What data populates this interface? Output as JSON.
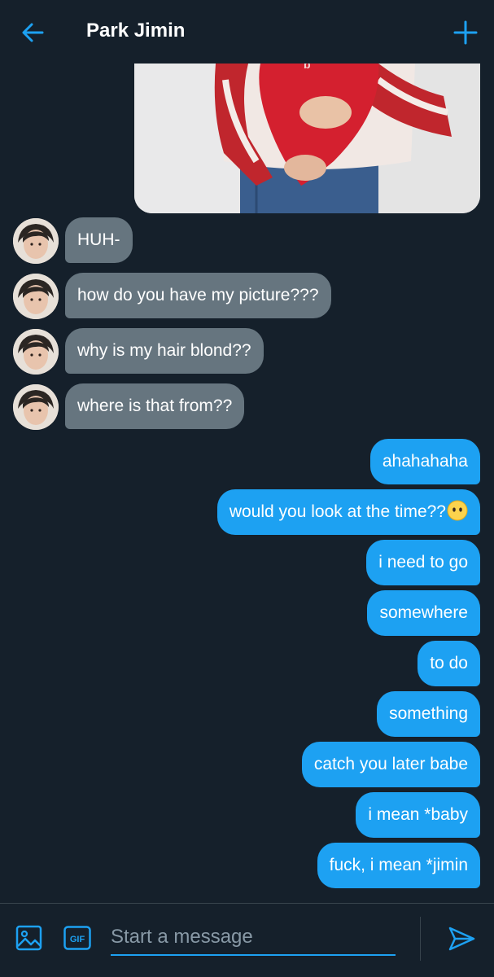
{
  "header": {
    "title": "Park Jimin",
    "back_icon": "arrow-left-icon",
    "add_icon": "plus-icon"
  },
  "conversation": {
    "received": [
      {
        "text": "HUH-"
      },
      {
        "text": "how do you have my picture???"
      },
      {
        "text": "why is my hair blond??"
      },
      {
        "text": "where is that from??"
      }
    ],
    "sent": [
      {
        "text": "ahahahaha"
      },
      {
        "text": "would you look at the time??",
        "emoji": "no-mouth-face-emoji"
      },
      {
        "text": "i need to go"
      },
      {
        "text": "somewhere"
      },
      {
        "text": "to do"
      },
      {
        "text": "something"
      },
      {
        "text": "catch you later babe"
      },
      {
        "text": "i mean *baby"
      },
      {
        "text": "fuck, i mean *jimin"
      }
    ]
  },
  "composer": {
    "placeholder": "Start a message",
    "gif_label": "GIF",
    "media_icon": "image-icon",
    "send_icon": "send-icon"
  },
  "colors": {
    "background": "#15202b",
    "accent": "#1da1f2",
    "received_bubble": "#66757f",
    "placeholder": "#8899a6"
  }
}
